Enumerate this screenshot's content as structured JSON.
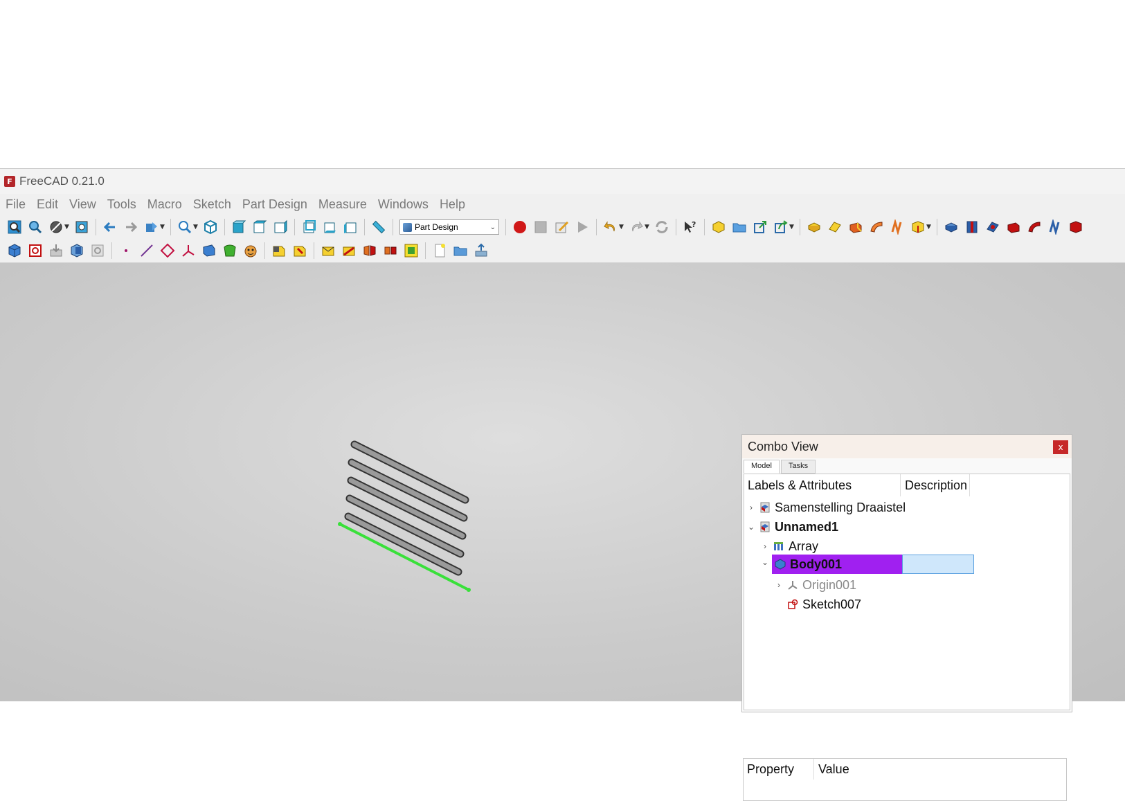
{
  "window": {
    "title": "FreeCAD 0.21.0",
    "logo_text": "F"
  },
  "menubar": {
    "items": [
      "File",
      "Edit",
      "View",
      "Tools",
      "Macro",
      "Sketch",
      "Part Design",
      "Measure",
      "Windows",
      "Help"
    ]
  },
  "toolbar": {
    "workbench": "Part Design"
  },
  "combo_view": {
    "title": "Combo View",
    "close": "x",
    "tabs": [
      "Model",
      "Tasks"
    ],
    "headers": {
      "labels": "Labels & Attributes",
      "description": "Description"
    },
    "tree": [
      {
        "label": "Samenstelling Draaistel",
        "chevron": "›"
      },
      {
        "label": "Unnamed1",
        "chevron": "⌄"
      },
      {
        "label": "Array",
        "chevron": "›"
      },
      {
        "label": "Body001",
        "chevron": "⌄"
      },
      {
        "label": "Origin001",
        "chevron": "›"
      },
      {
        "label": "Sketch007",
        "chevron": ""
      }
    ]
  },
  "property_panel": {
    "headers": {
      "property": "Property",
      "value": "Value"
    }
  },
  "colors": {
    "selection": "#a020f0",
    "sketch_line": "#39e03a",
    "close_button": "#c62828"
  }
}
